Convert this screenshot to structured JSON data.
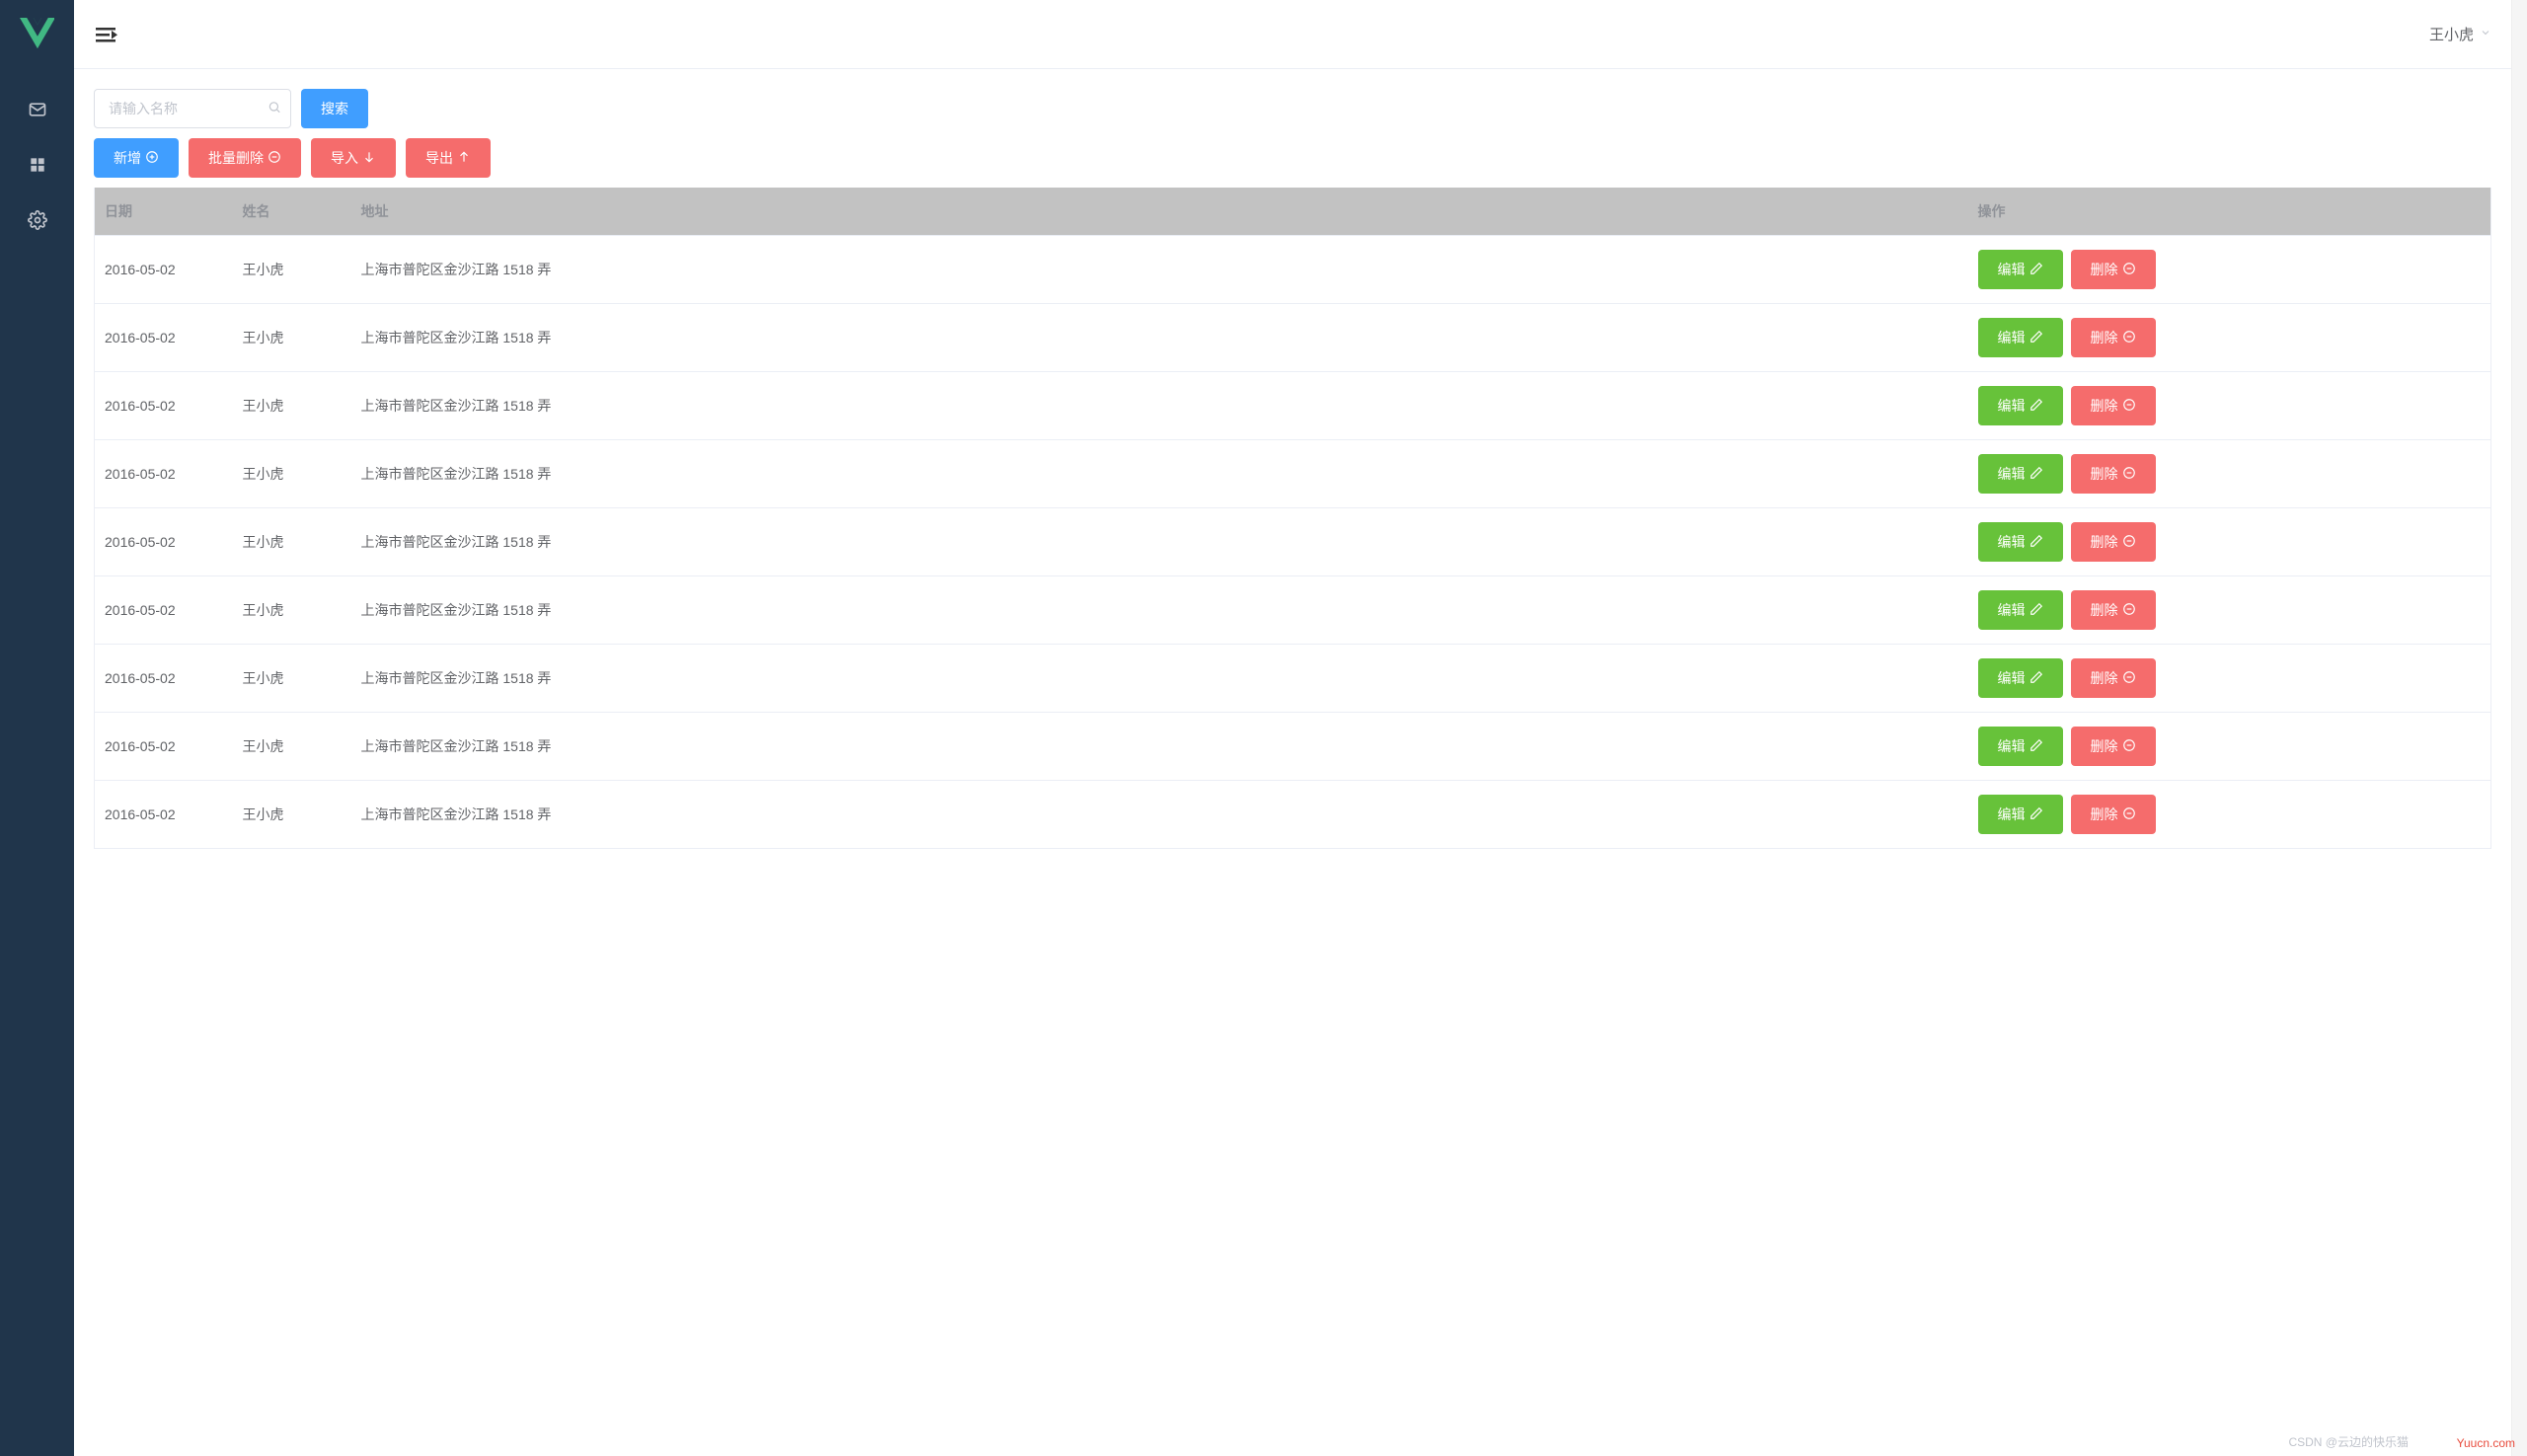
{
  "sidebar": {
    "logo_name": "vue-logo",
    "items": [
      {
        "name": "mail-icon"
      },
      {
        "name": "grid-icon"
      },
      {
        "name": "gear-icon"
      }
    ]
  },
  "topbar": {
    "user_label": "王小虎"
  },
  "toolbar": {
    "search_placeholder": "请输入名称",
    "search_button": "搜索",
    "add_button": "新增",
    "batch_delete_button": "批量删除",
    "import_button": "导入",
    "export_button": "导出"
  },
  "table": {
    "headers": {
      "date": "日期",
      "name": "姓名",
      "address": "地址",
      "action": "操作"
    },
    "row_actions": {
      "edit": "编辑",
      "delete": "删除"
    },
    "rows": [
      {
        "date": "2016-05-02",
        "name": "王小虎",
        "address": "上海市普陀区金沙江路 1518 弄"
      },
      {
        "date": "2016-05-02",
        "name": "王小虎",
        "address": "上海市普陀区金沙江路 1518 弄"
      },
      {
        "date": "2016-05-02",
        "name": "王小虎",
        "address": "上海市普陀区金沙江路 1518 弄"
      },
      {
        "date": "2016-05-02",
        "name": "王小虎",
        "address": "上海市普陀区金沙江路 1518 弄"
      },
      {
        "date": "2016-05-02",
        "name": "王小虎",
        "address": "上海市普陀区金沙江路 1518 弄"
      },
      {
        "date": "2016-05-02",
        "name": "王小虎",
        "address": "上海市普陀区金沙江路 1518 弄"
      },
      {
        "date": "2016-05-02",
        "name": "王小虎",
        "address": "上海市普陀区金沙江路 1518 弄"
      },
      {
        "date": "2016-05-02",
        "name": "王小虎",
        "address": "上海市普陀区金沙江路 1518 弄"
      },
      {
        "date": "2016-05-02",
        "name": "王小虎",
        "address": "上海市普陀区金沙江路 1518 弄"
      }
    ]
  },
  "watermark": {
    "site": "Yuucn.com",
    "csdn": "CSDN @云边的快乐猫"
  }
}
